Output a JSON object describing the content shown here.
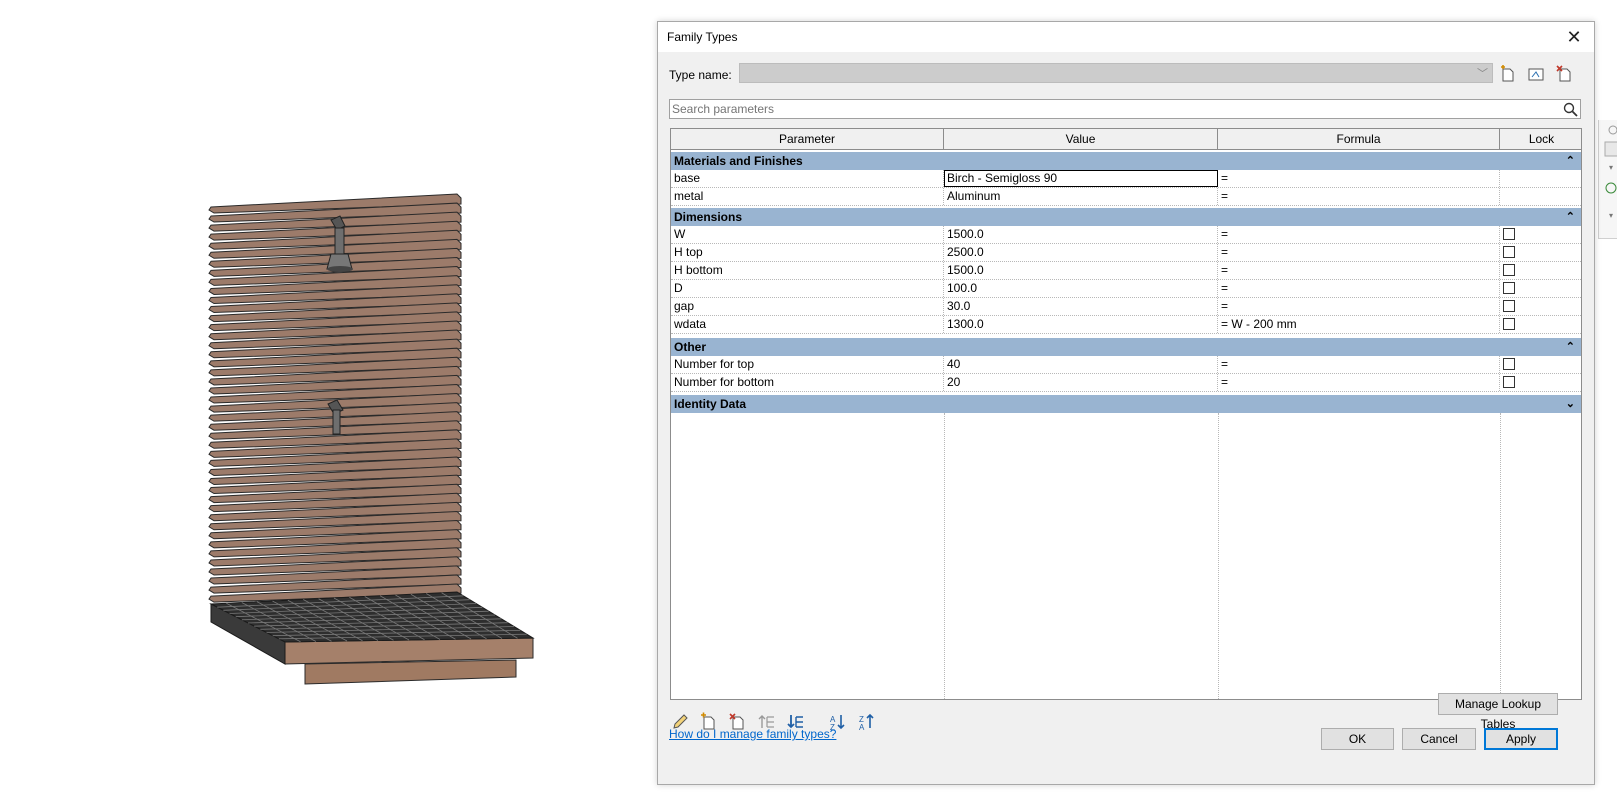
{
  "dialog": {
    "title": "Family Types",
    "type_name_label": "Type name:",
    "type_name_value": "",
    "search_placeholder": "Search parameters"
  },
  "columns": {
    "parameter": "Parameter",
    "value": "Value",
    "formula": "Formula",
    "lock": "Lock"
  },
  "groups": [
    {
      "name": "Materials and Finishes",
      "toggle": "⌃",
      "rows": [
        {
          "param": "base",
          "value": "Birch - Semigloss 90",
          "formula": "=",
          "lock": null
        },
        {
          "param": "metal",
          "value": "Aluminum",
          "formula": "=",
          "lock": null
        }
      ]
    },
    {
      "name": "Dimensions",
      "toggle": "⌃",
      "rows": [
        {
          "param": "W",
          "value": "1500.0",
          "formula": "=",
          "lock": false
        },
        {
          "param": "H top",
          "value": "2500.0",
          "formula": "=",
          "lock": false
        },
        {
          "param": "H bottom",
          "value": "1500.0",
          "formula": "=",
          "lock": false
        },
        {
          "param": "D",
          "value": "100.0",
          "formula": "=",
          "lock": false
        },
        {
          "param": "gap",
          "value": "30.0",
          "formula": "=",
          "lock": false
        },
        {
          "param": "wdata",
          "value": "1300.0",
          "formula": "= W - 200 mm",
          "lock": false
        }
      ]
    },
    {
      "name": "Other",
      "toggle": "⌃",
      "rows": [
        {
          "param": "Number for top",
          "value": "40",
          "formula": "=",
          "lock": false
        },
        {
          "param": "Number for bottom",
          "value": "20",
          "formula": "=",
          "lock": false
        }
      ]
    },
    {
      "name": "Identity Data",
      "toggle": "⌄",
      "rows": []
    }
  ],
  "buttons": {
    "manage_lookup": "Manage Lookup Tables",
    "ok": "OK",
    "cancel": "Cancel",
    "apply": "Apply"
  },
  "help_link": "How do I manage family types?",
  "colors": {
    "group_header": "#99b4d1",
    "wood": "#9c7b6a",
    "accent": "#0078d7"
  }
}
